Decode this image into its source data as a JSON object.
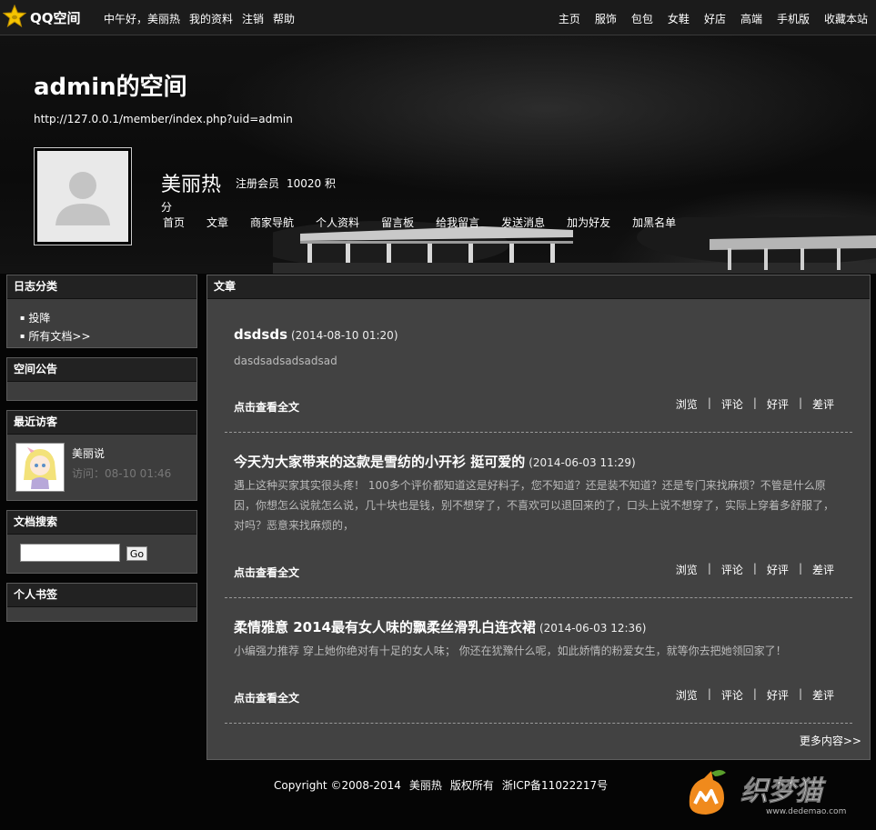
{
  "topbar": {
    "logo_text": "QQ空间",
    "left_links": [
      "中午好，美丽热",
      "我的资料",
      "注销",
      "帮助"
    ],
    "right_links": [
      "主页",
      "服饰",
      "包包",
      "女鞋",
      "好店",
      "高端",
      "手机版",
      "收藏本站"
    ]
  },
  "banner": {
    "title": "admin的空间",
    "url": "http://127.0.0.1/member/index.php?uid=admin",
    "user_name": "美丽热",
    "user_role": "注册会员",
    "user_points": "10020 积分",
    "nav": [
      "首页",
      "文章",
      "商家导航",
      "个人资料",
      "留言板",
      "给我留言",
      "发送消息",
      "加为好友",
      "加黑名单"
    ]
  },
  "sidebar": {
    "categories": {
      "title": "日志分类",
      "items": [
        "投降",
        "所有文档>>"
      ]
    },
    "announcement": {
      "title": "空间公告"
    },
    "visitors": {
      "title": "最近访客",
      "name": "美丽说",
      "time": "访问：08-10 01:46"
    },
    "search": {
      "title": "文档搜索",
      "button": "Go",
      "value": ""
    },
    "bookmarks": {
      "title": "个人书签"
    }
  },
  "main": {
    "title": "文章",
    "read_more": "点击查看全文",
    "actions": [
      "浏览",
      "评论",
      "好评",
      "差评"
    ],
    "more": "更多内容>>",
    "articles": [
      {
        "title": "dsdsds",
        "date": "(2014-08-10 01:20)",
        "body": "dasdsadsadsadsad"
      },
      {
        "title": "今天为大家带来的这款是雪纺的小开衫 挺可爱的",
        "date": "(2014-06-03 11:29)",
        "body": "遇上这种买家其实很头疼！ 100多个评价都知道这是好料子，您不知道？还是装不知道？还是专门来找麻烦？不管是什么原因，你想怎么说就怎么说，几十块也是钱，别不想穿了，不喜欢可以退回来的了，口头上说不想穿了，实际上穿着多舒服了，对吗？恶意来找麻烦的，"
      },
      {
        "title": "柔情雅意 2014最有女人味的飘柔丝滑乳白连衣裙",
        "date": "(2014-06-03 12:36)",
        "body": "小编强力推荐 穿上她你绝对有十足的女人味； 你还在犹豫什么呢，如此娇情的粉爱女生，就等你去把她领回家了！"
      }
    ]
  },
  "footer": {
    "copyright": "Copyright ©2008-2014",
    "owner": "美丽热",
    "rights": "版权所有",
    "icp": "浙ICP备11022217号"
  },
  "watermark": {
    "text": "织梦猫",
    "site": "www.dedemao.com"
  }
}
